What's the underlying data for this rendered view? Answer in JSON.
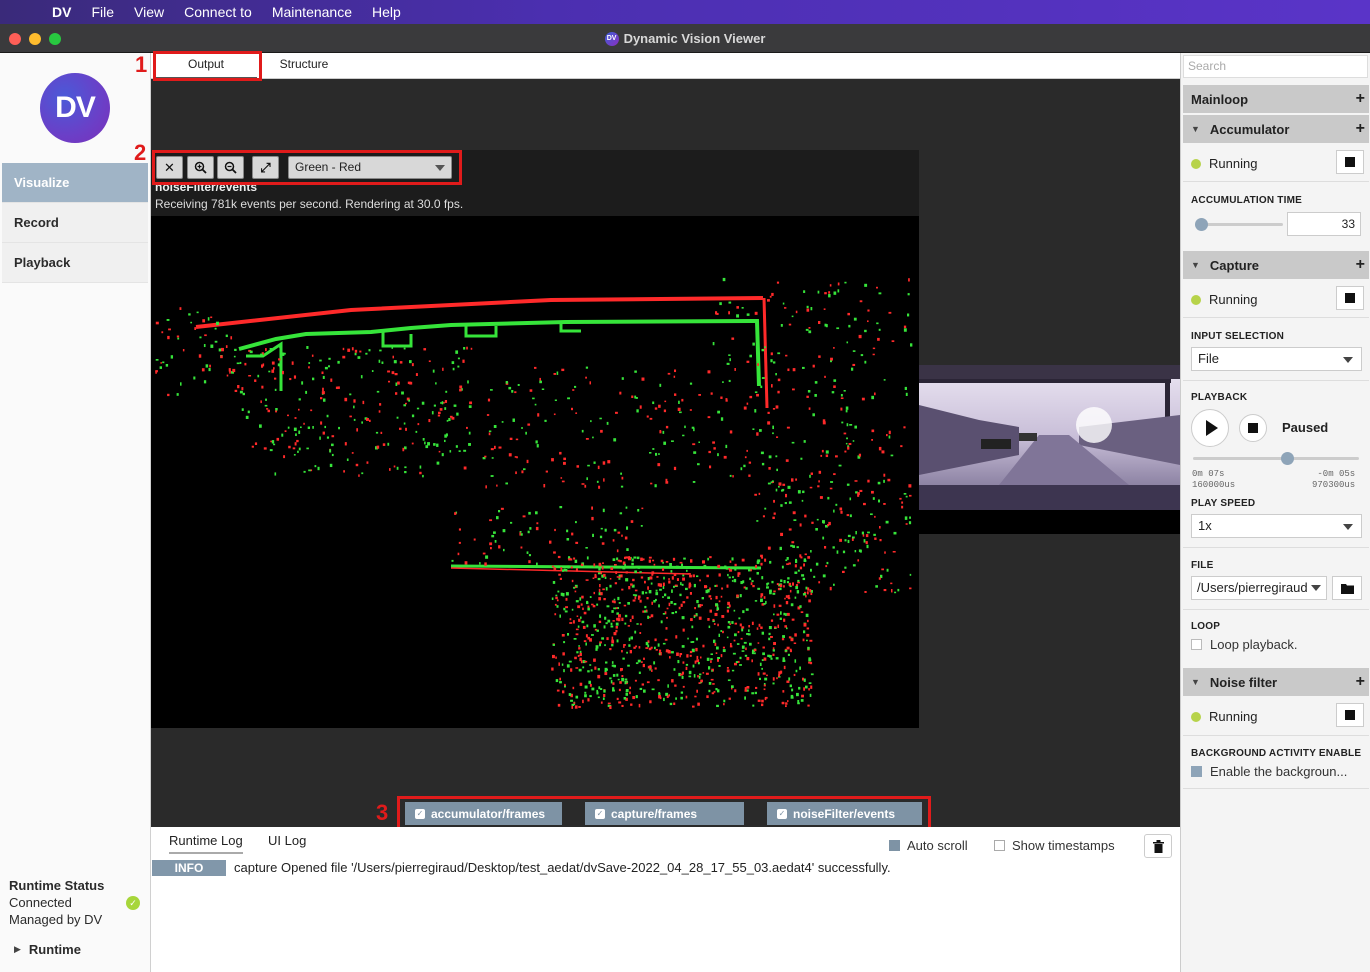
{
  "menubar": {
    "apple_icon": "apple-icon",
    "items": [
      "DV",
      "File",
      "View",
      "Connect to",
      "Maintenance",
      "Help"
    ]
  },
  "window": {
    "title": "Dynamic Vision Viewer"
  },
  "sidebar": {
    "logo_text": "DV",
    "nav": [
      "Visualize",
      "Record",
      "Playback"
    ],
    "active_nav": "Visualize",
    "runtime_status": {
      "title": "Runtime Status",
      "line1": "Connected",
      "line2": "Managed by DV"
    },
    "runtime_toggle": "Runtime"
  },
  "tabs": {
    "output": "Output",
    "structure": "Structure"
  },
  "annotations": {
    "one": "1",
    "two": "2",
    "three": "3"
  },
  "viewer": {
    "color_mode": "Green - Red",
    "stream_name": "noiseFilter/events",
    "stream_info": "Receiving 781k events per second.  Rendering at 30.0 fps."
  },
  "streams": [
    "accumulator/frames",
    "capture/frames",
    "noiseFilter/events"
  ],
  "log": {
    "tabs": [
      "Runtime Log",
      "UI Log"
    ],
    "auto_scroll": "Auto scroll",
    "show_timestamps": "Show timestamps",
    "entry": {
      "level": "INFO",
      "message": "capture Opened file '/Users/pierregiraud/Desktop/test_aedat/dvSave-2022_04_28_17_55_03.aedat4' successfully."
    }
  },
  "right_panel": {
    "search_placeholder": "Search",
    "mainloop": "Mainloop",
    "accumulator": {
      "title": "Accumulator",
      "status": "Running",
      "accumulation_label": "ACCUMULATION TIME",
      "accumulation_value": "33",
      "accumulation_level": 0.0
    },
    "capture": {
      "title": "Capture",
      "status": "Running",
      "input_label": "INPUT SELECTION",
      "input_value": "File",
      "playback_label": "PLAYBACK",
      "playback_state": "Paused",
      "playback_position": 0.55,
      "time_left": "0m 07s",
      "time_left_us": "160000us",
      "time_right": "-0m 05s",
      "time_right_us": "970300us",
      "speed_label": "PLAY SPEED",
      "speed_value": "1x",
      "file_label": "FILE",
      "file_value": "/Users/pierregiraud",
      "loop_label": "LOOP",
      "loop_text": "Loop playback."
    },
    "noise_filter": {
      "title": "Noise filter",
      "status": "Running",
      "bg_label": "BACKGROUND ACTIVITY ENABLE",
      "bg_text": "Enable the backgroun..."
    }
  },
  "colors": {
    "accent": "#8197aa",
    "running": "#b7d34a",
    "annotation": "#e01b1b"
  }
}
